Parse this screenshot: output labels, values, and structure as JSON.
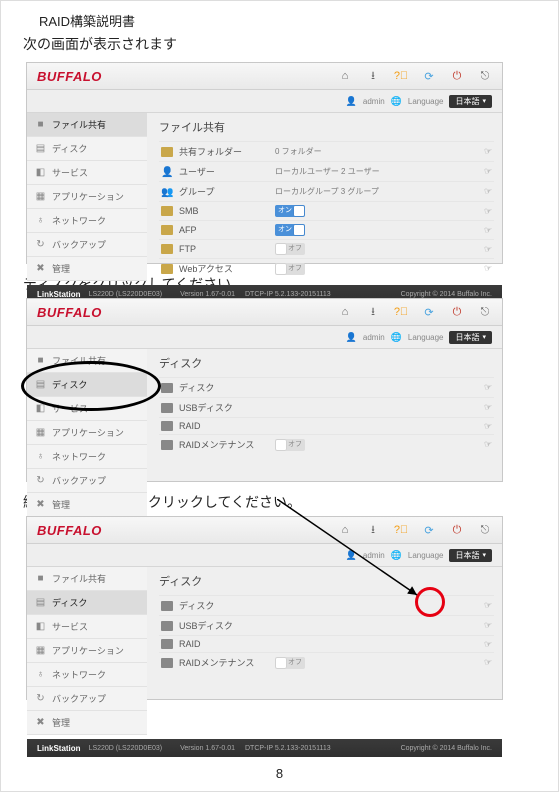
{
  "doc_title": "RAID構築説明書",
  "captions": {
    "c1": "次の画面が表示されます",
    "c2": "ディスクをクリックしてください。",
    "c3": "続いて、丸の部分をクリックしてください。"
  },
  "brand": "BUFFALO",
  "subbar": {
    "admin": "admin",
    "language": "Language",
    "lang_value": "日本語"
  },
  "sidebar": {
    "file_share": "ファイル共有",
    "disk": "ディスク",
    "service": "サービス",
    "application": "アプリケーション",
    "network": "ネットワーク",
    "backup": "バックアップ",
    "manage": "管理"
  },
  "fs_panel": {
    "title": "ファイル共有",
    "rows": {
      "shared_folder": {
        "label": "共有フォルダー",
        "value": "0 フォルダー"
      },
      "user": {
        "label": "ユーザー",
        "value": "ローカルユーザー 2 ユーザー"
      },
      "group": {
        "label": "グループ",
        "value": "ローカルグループ 3 グループ"
      },
      "smb": {
        "label": "SMB",
        "toggle": "オン"
      },
      "afp": {
        "label": "AFP",
        "toggle": "オン"
      },
      "ftp": {
        "label": "FTP",
        "toggle_off": "オフ"
      },
      "web": {
        "label": "Webアクセス",
        "toggle_off": "オフ"
      }
    }
  },
  "disk_panel": {
    "title": "ディスク",
    "rows": {
      "disk": {
        "label": "ディスク"
      },
      "usb": {
        "label": "USBディスク"
      },
      "raid": {
        "label": "RAID"
      },
      "raidmnt": {
        "label": "RAIDメンテナンス",
        "toggle_off": "オフ"
      }
    }
  },
  "footer": {
    "product": "LinkStation",
    "model": "LS220D (LS220D0E03)",
    "version": "Version 1.67-0.01",
    "dtcpip": "DTCP-IP 5.2.133-20151113",
    "copyright": "Copyright © 2014 Buffalo Inc."
  },
  "page_number": "8"
}
